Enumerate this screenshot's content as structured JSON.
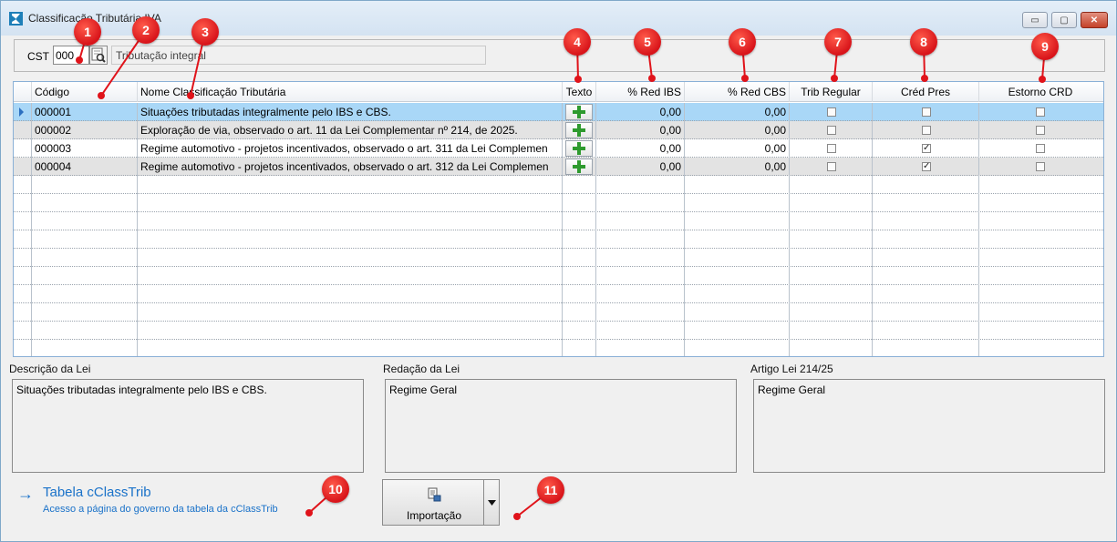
{
  "window": {
    "title": "Classificação Tributária IVA",
    "minimize_glyph": "▭",
    "maximize_glyph": "▢",
    "close_glyph": "✕"
  },
  "cst": {
    "label": "CST",
    "value": "000",
    "description": "Tributação integral"
  },
  "grid": {
    "columns": [
      "Código",
      "Nome Classificação Tributária",
      "Texto",
      "% Red IBS",
      "% Red CBS",
      "Trib Regular",
      "Créd Pres",
      "Estorno CRD"
    ],
    "rows": [
      {
        "codigo": "000001",
        "nome": "Situações tributadas integralmente pelo IBS e CBS.",
        "red_ibs": "0,00",
        "red_cbs": "0,00",
        "trib_regular": false,
        "cred_pres": false,
        "estorno_crd": false
      },
      {
        "codigo": "000002",
        "nome": "Exploração de via, observado o art. 11 da Lei Complementar nº 214, de 2025.",
        "red_ibs": "0,00",
        "red_cbs": "0,00",
        "trib_regular": false,
        "cred_pres": false,
        "estorno_crd": false
      },
      {
        "codigo": "000003",
        "nome": "Regime automotivo - projetos incentivados, observado o art. 311 da Lei Complemen",
        "red_ibs": "0,00",
        "red_cbs": "0,00",
        "trib_regular": false,
        "cred_pres": true,
        "estorno_crd": false
      },
      {
        "codigo": "000004",
        "nome": "Regime automotivo - projetos incentivados, observado o art. 312 da Lei Complemen",
        "red_ibs": "0,00",
        "red_cbs": "0,00",
        "trib_regular": false,
        "cred_pres": true,
        "estorno_crd": false
      }
    ]
  },
  "sections": {
    "descricao_label": "Descrição da Lei",
    "descricao_text": "Situações tributadas integralmente pelo IBS e CBS.",
    "redacao_label": "Redação da Lei",
    "redacao_text": "Regime Geral",
    "artigo_label": "Artigo Lei 214/25",
    "artigo_text": "Regime Geral"
  },
  "link": {
    "arrow": "→",
    "title": "Tabela cClassTrib",
    "subtitle": "Acesso a página do governo da tabela da cClassTrib"
  },
  "import_button": {
    "label": "Importação"
  },
  "annotations": [
    "1",
    "2",
    "3",
    "4",
    "5",
    "6",
    "7",
    "8",
    "9",
    "10",
    "11"
  ],
  "colors": {
    "selection": "#a9d7f7",
    "badge": "#e0131a",
    "link": "#1a72c9"
  }
}
